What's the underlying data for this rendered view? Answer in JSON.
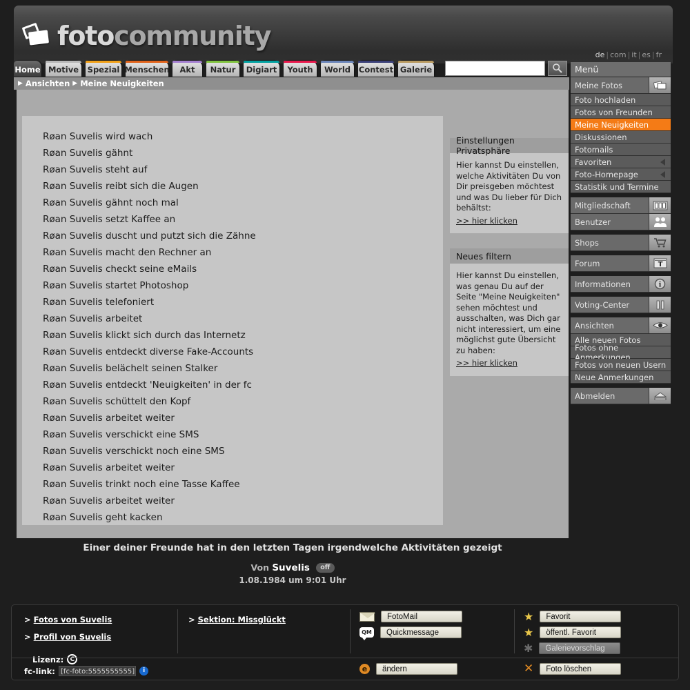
{
  "header": {
    "logo_word1": "foto",
    "logo_word2": "community",
    "logo_icon": "photos-stack-icon",
    "languages": [
      "de",
      "com",
      "it",
      "es",
      "fr"
    ],
    "active_language": "de"
  },
  "tabs": [
    {
      "label": "Home",
      "color": "#444444",
      "active": true,
      "width": 40
    },
    {
      "label": "Motive",
      "color": "#b8b8b8",
      "active": false,
      "width": 52
    },
    {
      "label": "Spezial",
      "color": "#f0a018",
      "active": false,
      "width": 52
    },
    {
      "label": "Menschen",
      "color": "#e0621a",
      "active": false,
      "width": 62
    },
    {
      "label": "Akt",
      "color": "#a47fd0",
      "active": false,
      "width": 43
    },
    {
      "label": "Natur",
      "color": "#7fc23e",
      "active": false,
      "width": 48
    },
    {
      "label": "Digiart",
      "color": "#00a0a0",
      "active": false,
      "width": 52
    },
    {
      "label": "Youth",
      "color": "#e8174b",
      "active": false,
      "width": 48
    },
    {
      "label": "World",
      "color": "#6a84b8",
      "active": false,
      "width": 48
    },
    {
      "label": "Contest",
      "color": "#3a3f78",
      "active": false,
      "width": 52
    },
    {
      "label": "Galerie",
      "color": "#b89a60",
      "active": false,
      "width": 52
    }
  ],
  "search": {
    "value": "",
    "placeholder": "",
    "button_icon": "search-icon"
  },
  "breadcrumb": {
    "item1": "Ansichten",
    "item2": "Meine Neuigkeiten"
  },
  "activity_list": [
    "Røan Suvelis wird wach",
    "Røan Suvelis gähnt",
    "Røan Suvelis steht auf",
    "Røan Suvelis reibt sich die Augen",
    "Røan Suvelis gähnt noch mal",
    "Røan Suvelis setzt Kaffee an",
    "Røan Suvelis duscht und putzt sich die Zähne",
    "Røan Suvelis macht den Rechner an",
    "Røan Suvelis checkt seine eMails",
    "Røan Suvelis startet Photoshop",
    "Røan Suvelis telefoniert",
    "Røan Suvelis arbeitet",
    "Røan Suvelis klickt sich durch das Internetz",
    "Røan Suvelis entdeckt diverse Fake-Accounts",
    "Røan Suvelis belächelt seinen Stalker",
    "Røan Suvelis entdeckt 'Neuigkeiten' in der fc",
    "Røan Suvelis schüttelt den Kopf",
    "Røan Suvelis arbeitet weiter",
    "Røan Suvelis verschickt eine SMS",
    "Røan Suvelis verschickt noch eine SMS",
    "Røan Suvelis arbeitet weiter",
    "Røan Suvelis trinkt noch eine Tasse Kaffee",
    "Røan Suvelis arbeitet weiter",
    "Røan Suvelis geht kacken"
  ],
  "infobox_privacy": {
    "title": "Einstellungen Privatsphäre",
    "body": "Hier kannst Du einstellen, welche Aktivitäten Du von Dir preisgeben möchtest und was Du lieber für Dich behältst:",
    "link": ">> hier klicken"
  },
  "infobox_filter": {
    "title": "Neues filtern",
    "body": "Hier kannst Du einstellen, was genau Du auf der Seite \"Meine Neuigkeiten\" sehen möchtest und ausschalten, was Dich gar nicht interessiert, um eine möglichst gute Übersicht zu haben:",
    "link": ">> hier klicken"
  },
  "caption": {
    "headline": "Einer deiner Freunde hat in den letzten Tagen irgendwelche Aktivitäten gezeigt",
    "by_label": "Von",
    "username": "Suvelis",
    "status_badge": "off",
    "datetime": "1.08.1984 um 9:01 Uhr"
  },
  "menu": {
    "title": "Menü",
    "items": [
      {
        "label": "Meine Fotos",
        "type": "group",
        "icon": "photos-icon",
        "active": false
      },
      {
        "label": "Foto hochladen",
        "type": "item",
        "icon": null,
        "active": false
      },
      {
        "label": "Fotos von Freunden",
        "type": "item",
        "icon": null,
        "active": false
      },
      {
        "label": "Meine Neuigkeiten",
        "type": "item",
        "icon": null,
        "active": true
      },
      {
        "label": "Diskussionen",
        "type": "item",
        "icon": null,
        "active": false
      },
      {
        "label": "Fotomails",
        "type": "item",
        "icon": null,
        "active": false
      },
      {
        "label": "Favoriten",
        "type": "item",
        "icon": "caret-left-icon",
        "active": false
      },
      {
        "label": "Foto-Homepage",
        "type": "item",
        "icon": "caret-left-icon",
        "active": false
      },
      {
        "label": "Statistik und Termine",
        "type": "item",
        "icon": null,
        "active": false
      },
      {
        "label": "Mitgliedschaft",
        "type": "group",
        "icon": "cards-icon",
        "active": false
      },
      {
        "label": "Benutzer",
        "type": "group",
        "icon": "users-icon",
        "active": false
      },
      {
        "label": "Shops",
        "type": "group",
        "icon": "cart-icon",
        "active": false
      },
      {
        "label": "Forum",
        "type": "group",
        "icon": "text-t-icon",
        "active": false
      },
      {
        "label": "Informationen",
        "type": "group",
        "icon": "info-icon",
        "active": false
      },
      {
        "label": "Voting-Center",
        "type": "group",
        "icon": "bars-icon",
        "active": false
      },
      {
        "label": "Ansichten",
        "type": "group",
        "icon": "eye-icon",
        "active": false
      },
      {
        "label": "Alle neuen Fotos",
        "type": "item",
        "icon": null,
        "active": false
      },
      {
        "label": "Fotos ohne Anmerkungen",
        "type": "item",
        "icon": null,
        "active": false
      },
      {
        "label": "Fotos von neuen Usern",
        "type": "item",
        "icon": null,
        "active": false
      },
      {
        "label": "Neue Anmerkungen",
        "type": "item",
        "icon": null,
        "active": false
      },
      {
        "label": "Abmelden",
        "type": "group",
        "icon": "eject-icon",
        "active": false
      }
    ]
  },
  "footer": {
    "links": [
      {
        "prefix": ">",
        "label": "Fotos von Suvelis"
      },
      {
        "prefix": ">",
        "label": "Profil von Suvelis"
      }
    ],
    "license_label": "Lizenz:",
    "license_icon": "copyright-icon",
    "section": {
      "prefix": ">",
      "label": "Sektion: Missglückt"
    },
    "actions": [
      {
        "label": "FotoMail",
        "icon": "mail-icon",
        "disabled": false
      },
      {
        "label": "Quickmessage",
        "icon": "qm-icon",
        "disabled": false
      }
    ],
    "favorites": [
      {
        "label": "Favorit",
        "icon": "star-icon",
        "disabled": false
      },
      {
        "label": "öffentl. Favorit",
        "icon": "public-star-icon",
        "disabled": false
      },
      {
        "label": "Galerievorschlag",
        "icon": "star-dim-icon",
        "disabled": true
      }
    ],
    "fclink_label": "fc-link:",
    "fclink_value": "[fc-foto:5555555555]",
    "fclink_info_icon": "info-circle-icon",
    "edit_button": {
      "label": "ändern",
      "icon": "edit-e-icon"
    },
    "delete_button": {
      "label": "Foto löschen",
      "icon": "x-icon"
    }
  }
}
